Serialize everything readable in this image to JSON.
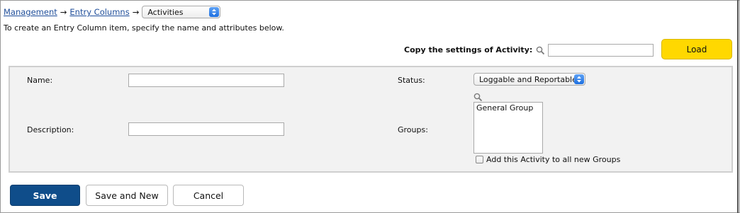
{
  "breadcrumb": {
    "items": [
      "Management",
      "Entry Columns"
    ],
    "separator": "→",
    "current_select": "Activities"
  },
  "intro_text": "To create an Entry Column item, specify the name and attributes below.",
  "copy_settings": {
    "label": "Copy the settings of Activity:",
    "input_value": "",
    "load_label": "Load"
  },
  "form": {
    "name_label": "Name:",
    "name_value": "",
    "description_label": "Description:",
    "description_value": "",
    "status_label": "Status:",
    "status_value": "Loggable and Reportable",
    "groups_label": "Groups:",
    "groups_options": [
      "General Group"
    ],
    "add_to_groups_label": "Add this Activity to all new Groups",
    "add_to_groups_checked": false
  },
  "actions": {
    "save_label": "Save",
    "save_new_label": "Save and New",
    "cancel_label": "Cancel"
  },
  "colors": {
    "accent_blue": "#0f4d8a",
    "load_yellow": "#ffd800",
    "link": "#1f4e9a"
  }
}
